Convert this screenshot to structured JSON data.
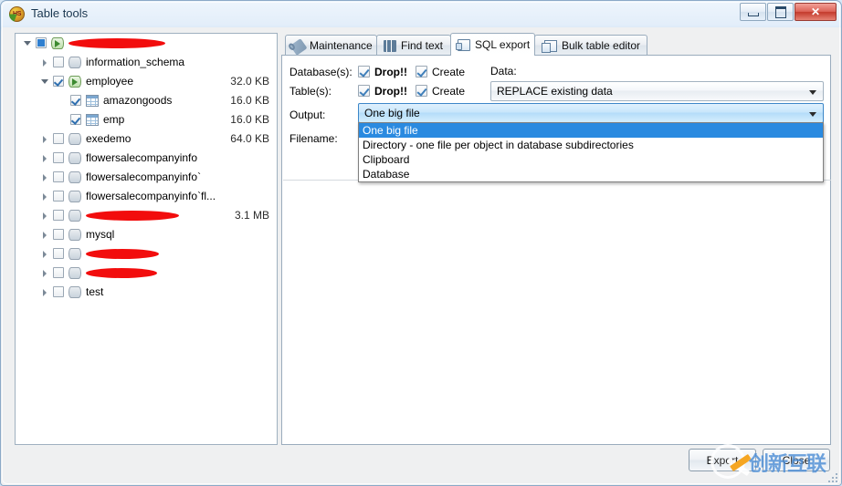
{
  "window": {
    "title": "Table tools",
    "icon": "hs-logo-icon",
    "minimize_label": "",
    "maximize_label": "",
    "close_label": "✕"
  },
  "tree": {
    "items": [
      {
        "indent": 0,
        "expander": "open",
        "check": "box",
        "icon": "database-icon-active",
        "label": "",
        "redacted": true,
        "redact_w": 106,
        "size": ""
      },
      {
        "indent": 1,
        "expander": "closed",
        "check": "empty",
        "icon": "database-icon",
        "label": "information_schema",
        "redacted": false,
        "size": ""
      },
      {
        "indent": 1,
        "expander": "open",
        "check": "checked",
        "icon": "database-icon-active",
        "label": "employee",
        "redacted": false,
        "size": "32.0 KB"
      },
      {
        "indent": 2,
        "expander": "none",
        "check": "checked",
        "icon": "table-icon",
        "label": "amazongoods",
        "redacted": false,
        "size": "16.0 KB"
      },
      {
        "indent": 2,
        "expander": "none",
        "check": "checked",
        "icon": "table-icon",
        "label": "emp",
        "redacted": false,
        "size": "16.0 KB"
      },
      {
        "indent": 1,
        "expander": "closed",
        "check": "empty",
        "icon": "database-icon",
        "label": "exedemo",
        "redacted": false,
        "size": "64.0 KB"
      },
      {
        "indent": 1,
        "expander": "closed",
        "check": "empty",
        "icon": "database-icon",
        "label": "flowersalecompanyinfo",
        "redacted": false,
        "size": ""
      },
      {
        "indent": 1,
        "expander": "closed",
        "check": "empty",
        "icon": "database-icon",
        "label": "flowersalecompanyinfo`",
        "redacted": false,
        "size": ""
      },
      {
        "indent": 1,
        "expander": "closed",
        "check": "empty",
        "icon": "database-icon",
        "label": "flowersalecompanyinfo`fl...",
        "redacted": false,
        "size": ""
      },
      {
        "indent": 1,
        "expander": "closed",
        "check": "empty",
        "icon": "database-icon",
        "label": "",
        "redacted": true,
        "redact_w": 102,
        "size": "3.1 MB"
      },
      {
        "indent": 1,
        "expander": "closed",
        "check": "empty",
        "icon": "database-icon",
        "label": "mysql",
        "redacted": false,
        "size": ""
      },
      {
        "indent": 1,
        "expander": "closed",
        "check": "empty",
        "icon": "database-icon",
        "label": "",
        "redacted": true,
        "redact_w": 80,
        "size": ""
      },
      {
        "indent": 1,
        "expander": "closed",
        "check": "empty",
        "icon": "database-icon",
        "label": "",
        "redacted": true,
        "redact_w": 78,
        "size": ""
      },
      {
        "indent": 1,
        "expander": "closed",
        "check": "empty",
        "icon": "database-icon",
        "label": "test",
        "redacted": false,
        "size": ""
      }
    ]
  },
  "tabs": [
    {
      "label": "Maintenance",
      "icon": "wrench-icon",
      "active": false
    },
    {
      "label": "Find text",
      "icon": "find-text-icon",
      "active": false
    },
    {
      "label": "SQL export",
      "icon": "sql-export-icon",
      "active": true
    },
    {
      "label": "Bulk table editor",
      "icon": "bulk-editor-icon",
      "active": false
    }
  ],
  "sql_export": {
    "databases_label": "Database(s):",
    "tables_label": "Table(s):",
    "output_label": "Output:",
    "filename_label": "Filename:",
    "data_label": "Data:",
    "db_drop_label": "Drop!!",
    "db_create_label": "Create",
    "tbl_drop_label": "Drop!!",
    "tbl_create_label": "Create",
    "data_value": "REPLACE existing data",
    "output_value": "One big file",
    "filename_value": "",
    "output_options": [
      "One big file",
      "Directory - one file per object in database subdirectories",
      "Clipboard",
      "Database"
    ],
    "output_selected_index": 0
  },
  "footer": {
    "export_label": "Export",
    "close_label": "Close"
  },
  "watermark": {
    "text": "创新互联",
    "logo": "circle-x-logo-icon"
  },
  "colors": {
    "accent": "#2a8ae0",
    "redaction": "#f20d0d",
    "title_text": "#16344f",
    "close_button": "#c43a2c"
  }
}
